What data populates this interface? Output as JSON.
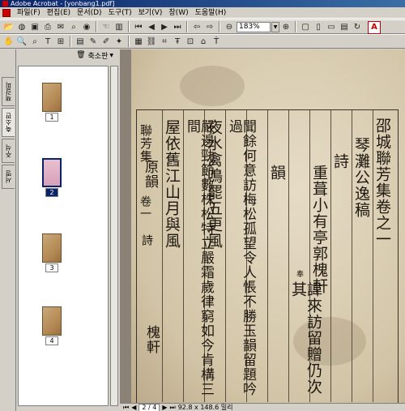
{
  "window": {
    "title": "Adobe Acrobat - [yonbang1.pdf]"
  },
  "menu": [
    "파일(F)",
    "편집(E)",
    "문서(D)",
    "도구(T)",
    "보기(V)",
    "창(W)",
    "도움말(H)"
  ],
  "toolbar": {
    "zoom_value": "183%"
  },
  "side_tabs": [
    "책갈피",
    "축소판",
    "주석",
    "서명"
  ],
  "panel": {
    "header_label": "축소판"
  },
  "thumbnails": [
    {
      "label": "1",
      "selected": false
    },
    {
      "label": "2",
      "selected": true
    },
    {
      "label": "3",
      "selected": false
    },
    {
      "label": "4",
      "selected": false
    }
  ],
  "status": {
    "page_indicator": "2 / 4",
    "page_size": "92.8 x 148.6 밀리"
  },
  "document": {
    "columns": [
      "邵城聯芳集卷之一",
      "琴灘公逸稿",
      "詩",
      "重葺小有亭郭槐軒",
      "諱來訪留贈仍次其",
      "韻",
      "聞餘何意訪梅松孤望令人悵不勝玉韻留題吟過",
      "夜水禽鳴罷五更風",
      "嚴邊勁節數株松特立嚴霜歲律窮如今肯構三間",
      "屋依舊江山月與風",
      "原韻"
    ],
    "margin_top": "聯芳集",
    "margin_mid": "卷一",
    "margin_low": "詩",
    "signature": "槐軒",
    "small_note": "奉"
  }
}
